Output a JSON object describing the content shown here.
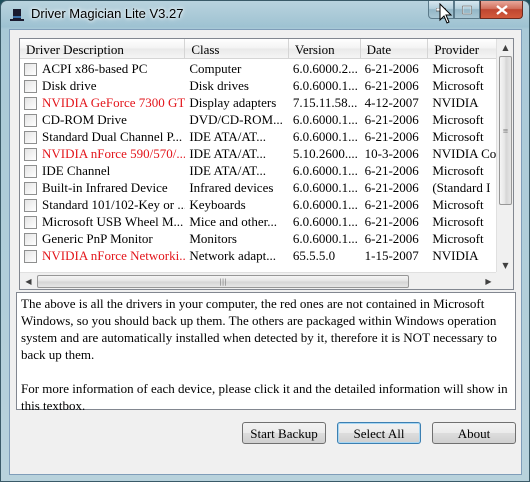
{
  "window": {
    "title": "Driver Magician Lite V3.27"
  },
  "table": {
    "columns": [
      "Driver Description",
      "Class",
      "Version",
      "Date",
      "Provider"
    ],
    "rows": [
      {
        "description": "ACPI x86-based PC",
        "class": "Computer",
        "version": "6.0.6000.2...",
        "date": "6-21-2006",
        "provider": "Microsoft",
        "red": false
      },
      {
        "description": "Disk drive",
        "class": "Disk drives",
        "version": "6.0.6000.1...",
        "date": "6-21-2006",
        "provider": "Microsoft",
        "red": false
      },
      {
        "description": "NVIDIA GeForce 7300 GT",
        "class": "Display adapters",
        "version": "7.15.11.58...",
        "date": "4-12-2007",
        "provider": "NVIDIA",
        "red": true
      },
      {
        "description": "CD-ROM Drive",
        "class": "DVD/CD-ROM...",
        "version": "6.0.6000.1...",
        "date": "6-21-2006",
        "provider": "Microsoft",
        "red": false
      },
      {
        "description": "Standard Dual Channel P...",
        "class": "IDE ATA/AT...",
        "version": "6.0.6000.1...",
        "date": "6-21-2006",
        "provider": "Microsoft",
        "red": false
      },
      {
        "description": "NVIDIA nForce 590/570/...",
        "class": "IDE ATA/AT...",
        "version": "5.10.2600....",
        "date": "10-3-2006",
        "provider": "NVIDIA Co",
        "red": true
      },
      {
        "description": "IDE Channel",
        "class": "IDE ATA/AT...",
        "version": "6.0.6000.1...",
        "date": "6-21-2006",
        "provider": "Microsoft",
        "red": false
      },
      {
        "description": "Built-in Infrared Device",
        "class": "Infrared devices",
        "version": "6.0.6000.1...",
        "date": "6-21-2006",
        "provider": "(Standard I",
        "red": false
      },
      {
        "description": "Standard 101/102-Key or ...",
        "class": "Keyboards",
        "version": "6.0.6000.1...",
        "date": "6-21-2006",
        "provider": "Microsoft",
        "red": false
      },
      {
        "description": "Microsoft USB Wheel M...",
        "class": "Mice and other...",
        "version": "6.0.6000.1...",
        "date": "6-21-2006",
        "provider": "Microsoft",
        "red": false
      },
      {
        "description": "Generic PnP Monitor",
        "class": "Monitors",
        "version": "6.0.6000.1...",
        "date": "6-21-2006",
        "provider": "Microsoft",
        "red": false
      },
      {
        "description": "NVIDIA nForce Networki...",
        "class": "Network adapt...",
        "version": "65.5.5.0",
        "date": "1-15-2007",
        "provider": "NVIDIA",
        "red": true
      }
    ]
  },
  "info": {
    "paragraph1": "The above is all the drivers in your computer, the red ones are not contained in Microsoft Windows, so you should back up them. The others are packaged within Windows operation system and are automatically installed when detected by it, therefore it is NOT necessary to back up them.",
    "paragraph2": "For more information of each device, please click it and the detailed information will show in this textbox."
  },
  "buttons": {
    "start_backup": "Start Backup",
    "select_all": "Select All",
    "about": "About"
  },
  "colors": {
    "red_driver": "#e3151b"
  },
  "icons": {
    "app": "magician-hat-icon",
    "minimize": "minimize-icon",
    "maximize": "maximize-icon",
    "close": "close-icon"
  }
}
